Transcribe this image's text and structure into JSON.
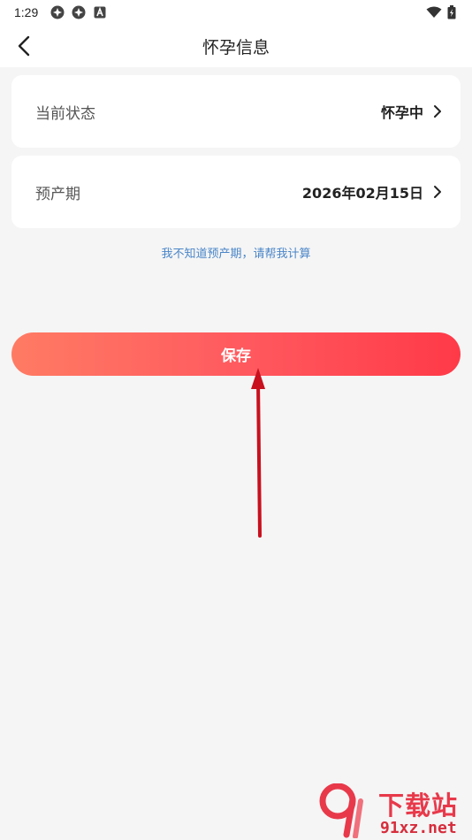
{
  "status_bar": {
    "time": "1:29",
    "left_icons": [
      "app-notification-icon",
      "app-notification-icon",
      "a-letter-icon"
    ],
    "right_icons": [
      "wifi-icon",
      "battery-icon"
    ]
  },
  "header": {
    "title": "怀孕信息",
    "back_icon": "chevron-left-icon"
  },
  "cards": [
    {
      "label": "当前状态",
      "value": "怀孕中"
    },
    {
      "label": "预产期",
      "value": "2026年02月15日"
    }
  ],
  "helper_link": "我不知道预产期，请帮我计算",
  "save_button": "保存",
  "colors": {
    "accent_start": "#ff7b63",
    "accent_end": "#ff3a48",
    "link": "#4a86c8",
    "annotation_arrow": "#c8101e"
  },
  "watermark": {
    "title": "下载站",
    "url": "91xz.net"
  }
}
